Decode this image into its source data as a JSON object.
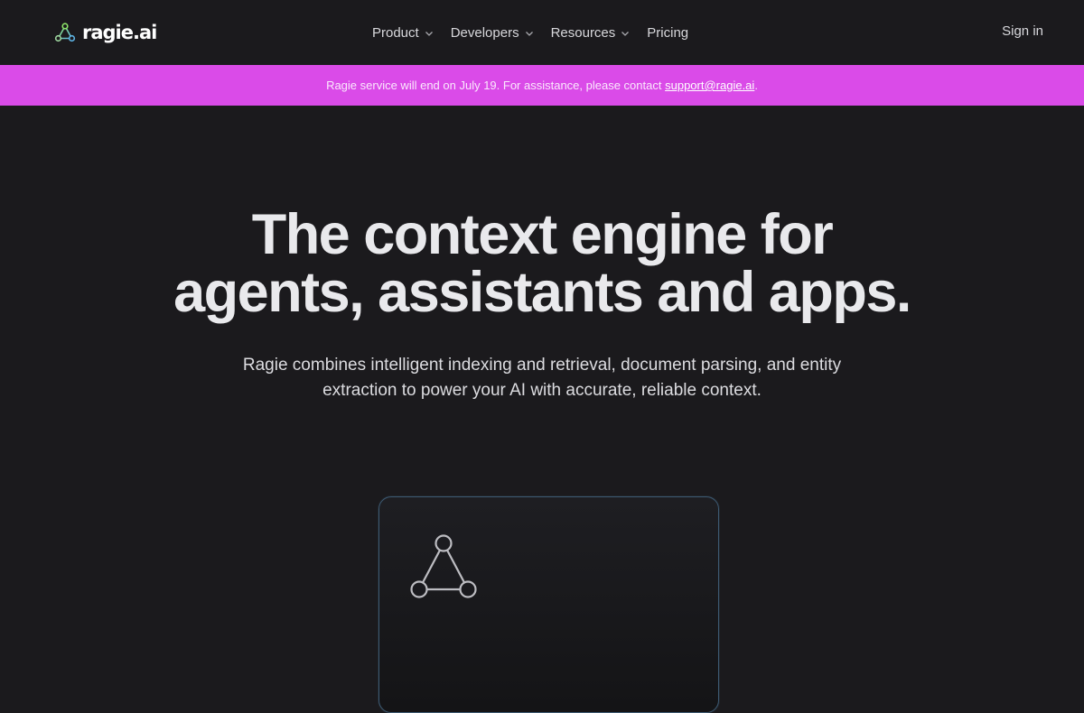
{
  "header": {
    "logo_text": "ragie.ai",
    "logo_icon": "triangle-nodes-icon",
    "nav": [
      {
        "label": "Product",
        "has_dropdown": true
      },
      {
        "label": "Developers",
        "has_dropdown": true
      },
      {
        "label": "Resources",
        "has_dropdown": true
      },
      {
        "label": "Pricing",
        "has_dropdown": false
      }
    ],
    "signin_label": "Sign in"
  },
  "banner": {
    "text": "Ragie service will end on July 19. For assistance, please contact ",
    "link_text": "support@ragie.ai",
    "suffix": ".",
    "background": "#da4be8"
  },
  "hero": {
    "title_line1": "The context engine for",
    "title_line2": "agents, assistants and apps.",
    "subtitle_line1": "Ragie combines intelligent indexing and retrieval, document parsing, and entity",
    "subtitle_line2": "extraction to power your AI with accurate, reliable context."
  },
  "card": {
    "icon": "triangle-nodes-icon"
  },
  "colors": {
    "background": "#1b1a1d",
    "accent": "#da4be8"
  }
}
